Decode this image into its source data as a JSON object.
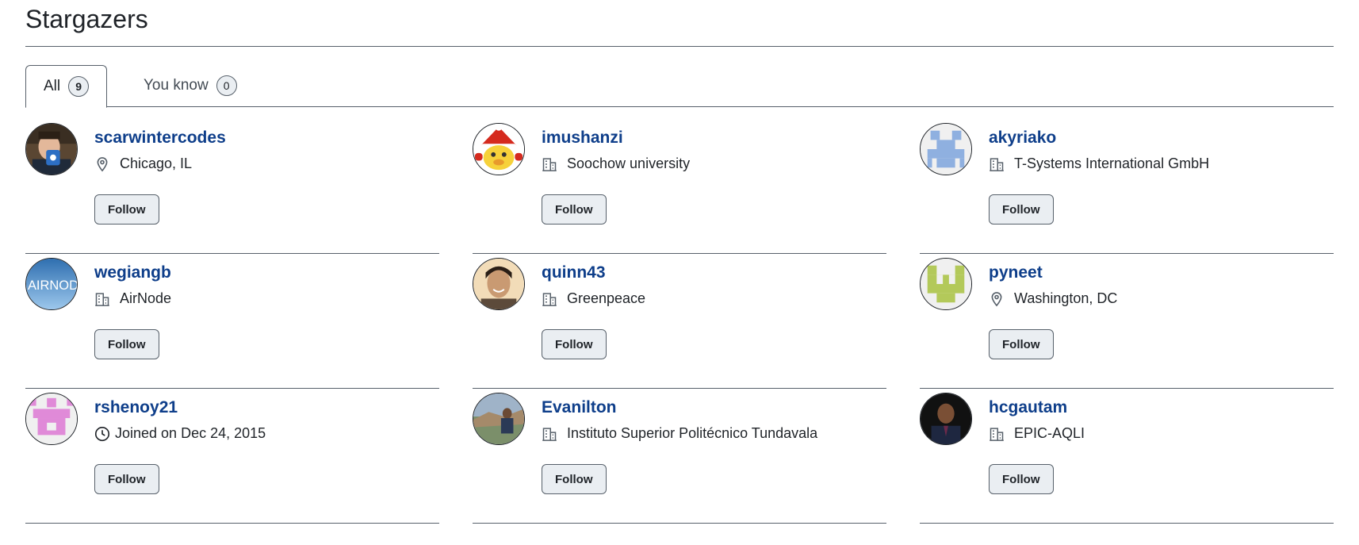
{
  "page": {
    "title": "Stargazers"
  },
  "tabs": [
    {
      "label": "All",
      "count": "9",
      "selected": true
    },
    {
      "label": "You know",
      "count": "0",
      "selected": false
    }
  ],
  "users": [
    {
      "username": "scarwintercodes",
      "meta_icon": "location-icon",
      "meta": "Chicago, IL",
      "follow_label": "Follow",
      "avatar": "photo-avatar"
    },
    {
      "username": "imushanzi",
      "meta_icon": "organization-icon",
      "meta": "Soochow university",
      "follow_label": "Follow",
      "avatar": "cartoon-avatar"
    },
    {
      "username": "akyriako",
      "meta_icon": "organization-icon",
      "meta": "T-Systems International GmbH",
      "follow_label": "Follow",
      "avatar": "identicon-blue"
    },
    {
      "username": "wegiangb",
      "meta_icon": "organization-icon",
      "meta": "AirNode",
      "follow_label": "Follow",
      "avatar": "logo-avatar"
    },
    {
      "username": "quinn43",
      "meta_icon": "organization-icon",
      "meta": "Greenpeace",
      "follow_label": "Follow",
      "avatar": "photo-avatar"
    },
    {
      "username": "pyneet",
      "meta_icon": "location-icon",
      "meta": "Washington, DC",
      "follow_label": "Follow",
      "avatar": "identicon-green"
    },
    {
      "username": "rshenoy21",
      "meta_icon": "clock-icon",
      "meta": "Joined on Dec 24, 2015",
      "follow_label": "Follow",
      "avatar": "identicon-pink"
    },
    {
      "username": "Evanilton",
      "meta_icon": "organization-icon",
      "meta": "Instituto Superior Politécnico Tundavala",
      "follow_label": "Follow",
      "avatar": "photo-avatar"
    },
    {
      "username": "hcgautam",
      "meta_icon": "organization-icon",
      "meta": "EPIC-AQLI",
      "follow_label": "Follow",
      "avatar": "photo-avatar"
    }
  ],
  "colors": {
    "link": "#0e3e8a",
    "border": "#57606a",
    "button_bg": "#eaeef2",
    "identicon_blue": "#8fb0e0",
    "identicon_green": "#b3c95a",
    "identicon_pink": "#e08ad8"
  }
}
